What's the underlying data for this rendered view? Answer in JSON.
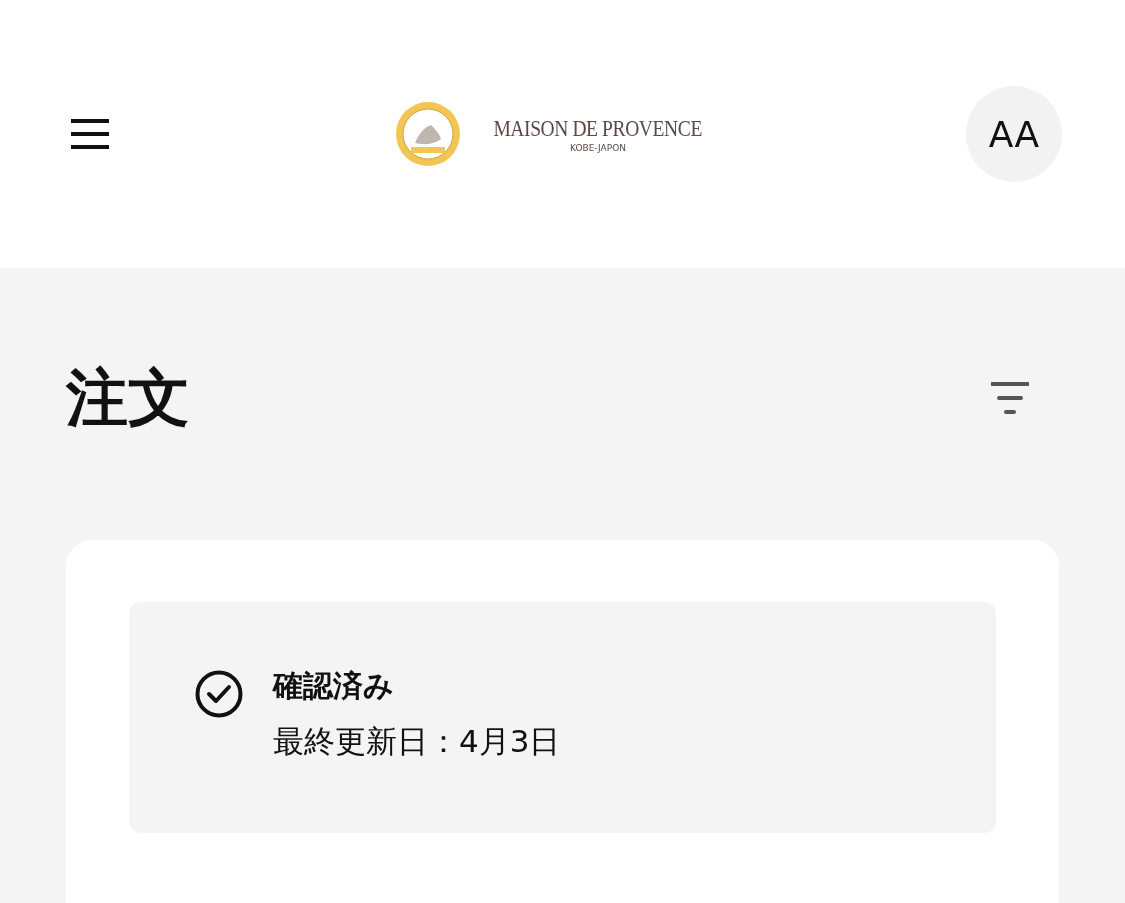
{
  "header": {
    "logo": {
      "name": "MAISON DE PROVENCE",
      "subtitle": "KOBE-JAPON"
    },
    "avatar": "AA"
  },
  "page": {
    "title": "注文"
  },
  "orders": [
    {
      "status": "確認済み",
      "updated": "最終更新日：4月3日"
    }
  ]
}
